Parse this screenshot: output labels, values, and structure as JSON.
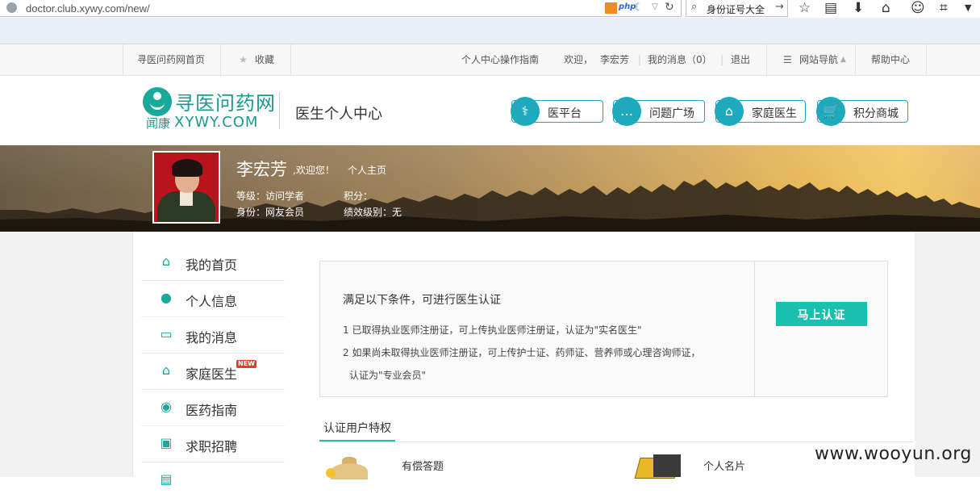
{
  "browser": {
    "url": "doctor.club.xywy.com/new/",
    "php_badge": "php",
    "search_value": "身份证号大全"
  },
  "topnav": {
    "home": "寻医问药网首页",
    "favorite": "收藏",
    "guide": "个人中心操作指南",
    "welcome": "欢迎，",
    "username": "李宏芳",
    "messages": "我的消息（0）",
    "logout": "退出",
    "site_nav": "网站导航",
    "help": "帮助中心"
  },
  "header": {
    "logo_cn": "寻医问药网",
    "logo_sub": "闻康",
    "logo_en": "XYWY.COM",
    "center_title": "医生个人中心",
    "buttons": [
      "医平台",
      "问题广场",
      "家庭医生",
      "积分商城"
    ]
  },
  "banner": {
    "name": "李宏芳",
    "welcome": ",欢迎您！",
    "homepage": "个人主页",
    "level": "等级：访问学者",
    "points": "积分：",
    "identity": "身份：网友会员",
    "performance": "绩效级别：无"
  },
  "sidebar": {
    "items": [
      {
        "label": "我的首页",
        "icon": "home-icon"
      },
      {
        "label": "个人信息",
        "icon": "person-icon"
      },
      {
        "label": "我的消息",
        "icon": "message-icon"
      },
      {
        "label": "家庭医生",
        "icon": "family-doctor-icon",
        "badge": "NEW"
      },
      {
        "label": "医药指南",
        "icon": "compass-icon"
      },
      {
        "label": "求职招聘",
        "icon": "resume-icon"
      }
    ]
  },
  "cert": {
    "title": "满足以下条件，可进行医生认证",
    "line1": "1 已取得执业医师注册证，可上传执业医师注册证，认证为\"实名医生\"",
    "line2": "2 如果尚未取得执业医师注册证，可上传护士证、药师证、营养师或心理咨询师证，",
    "line3": "认证为\"专业会员\"",
    "button": "马上认证"
  },
  "privileges": {
    "tab": "认证用户特权",
    "items": [
      "有偿答题",
      "个人名片"
    ]
  },
  "watermark": "www.wooyun.org",
  "colors": {
    "accent": "#1abfae",
    "orange": "#f07a12",
    "header_teal": "#1fa9bc"
  }
}
